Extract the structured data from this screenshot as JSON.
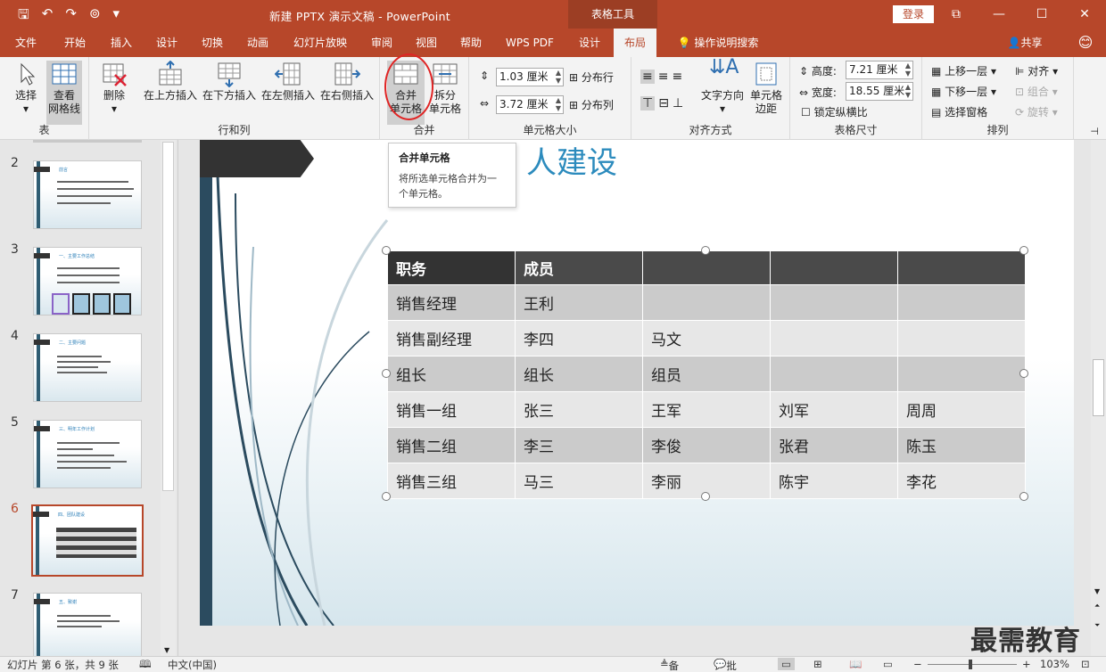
{
  "titlebar": {
    "title": "新建 PPTX 演示文稿  -  PowerPoint",
    "tool_tab": "表格工具",
    "login": "登录"
  },
  "tabs": [
    "文件",
    "开始",
    "插入",
    "设计",
    "切换",
    "动画",
    "幻灯片放映",
    "审阅",
    "视图",
    "帮助",
    "WPS PDF",
    "设计",
    "布局",
    "操作说明搜索",
    "共享"
  ],
  "ribbon": {
    "table_group": {
      "label": "表",
      "select": "选择",
      "gridlines": "查看\n网格线"
    },
    "rows_cols_group": {
      "label": "行和列",
      "delete": "删除",
      "above": "在上方插入",
      "below": "在下方插入",
      "left": "在左侧插入",
      "right": "在右侧插入"
    },
    "merge_group": {
      "label": "合并",
      "merge": "合并\n单元格",
      "split": "拆分\n单元格"
    },
    "cell_size_group": {
      "label": "单元格大小",
      "height": "1.03 厘米",
      "width": "3.72 厘米",
      "dist_rows": "分布行",
      "dist_cols": "分布列"
    },
    "align_group": {
      "label": "对齐方式",
      "text_dir": "文字方向",
      "margins": "单元格\n边距"
    },
    "table_size_group": {
      "label": "表格尺寸",
      "height_label": "高度:",
      "height": "7.21 厘米",
      "width_label": "宽度:",
      "width": "18.55 厘米",
      "lock": "锁定纵横比"
    },
    "arrange_group": {
      "label": "排列",
      "forward": "上移一层",
      "backward": "下移一层",
      "pane": "选择窗格",
      "align": "对齐",
      "group": "组合",
      "rotate": "旋转"
    }
  },
  "tooltip": {
    "title": "合并单元格",
    "desc": "将所选单元格合并为一个单元格。"
  },
  "slides": [
    {
      "num": "2",
      "title": "前言"
    },
    {
      "num": "3",
      "title": "一、主要工作总结"
    },
    {
      "num": "4",
      "title": "二、主要问题"
    },
    {
      "num": "5",
      "title": "三、明年工作计划"
    },
    {
      "num": "6",
      "title": "四、团队建设"
    },
    {
      "num": "7",
      "title": "五、致谢"
    }
  ],
  "slide": {
    "title": "人建设"
  },
  "table": {
    "header": [
      "职务",
      "成员",
      "",
      "",
      ""
    ],
    "rows": [
      [
        "销售经理",
        "王利",
        "",
        "",
        ""
      ],
      [
        "销售副经理",
        "李四",
        "马文",
        "",
        ""
      ],
      [
        "组长",
        "组长",
        "组员",
        "",
        ""
      ],
      [
        "销售一组",
        "张三",
        "王军",
        "刘军",
        "周周"
      ],
      [
        "销售二组",
        "李三",
        "李俊",
        "张君",
        "陈玉"
      ],
      [
        "销售三组",
        "马三",
        "李丽",
        "陈宇",
        "李花"
      ]
    ]
  },
  "status": {
    "slide_info": "幻灯片 第 6 张，共 9 张",
    "lang": "中文(中国)",
    "notes": "备注",
    "comments": "批注",
    "zoom": "103%"
  },
  "watermark": "最需教育"
}
